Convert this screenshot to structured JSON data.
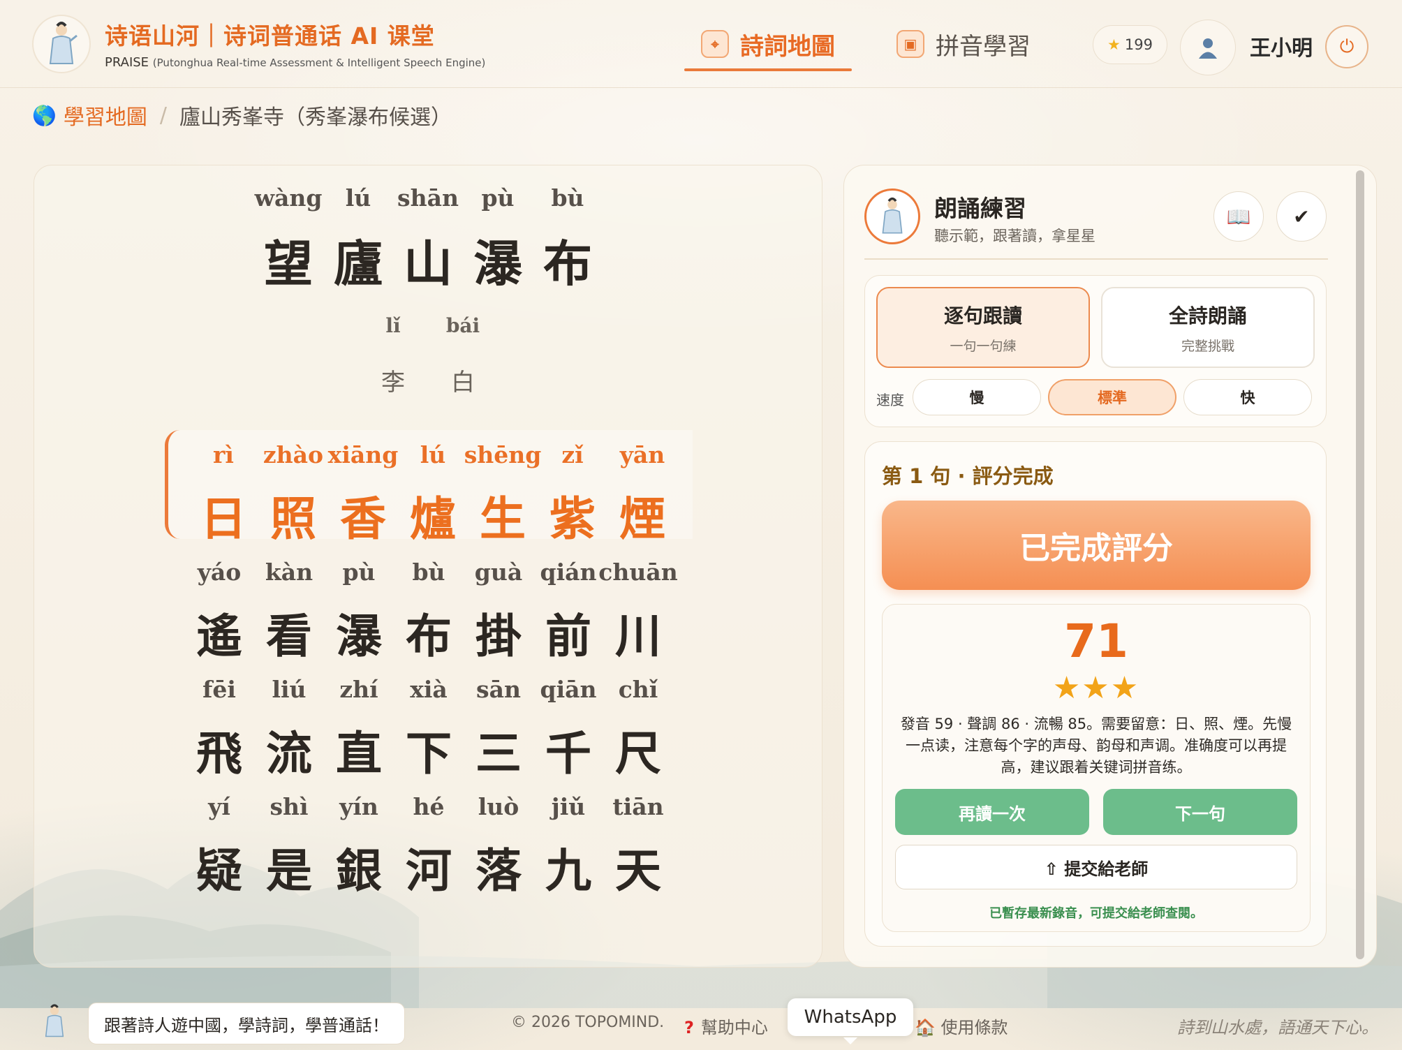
{
  "header": {
    "brand_title": "诗语山河｜诗词普通话 AI 课堂",
    "brand_acronym": "PRAISE",
    "brand_expansion": "(Putonghua Real-time Assessment & Intelligent Speech Engine)",
    "nav": [
      {
        "label": "詩詞地圖",
        "icon": "map-icon",
        "active": true
      },
      {
        "label": "拼音學習",
        "icon": "pinyin-card-icon",
        "active": false
      }
    ],
    "stars": "199",
    "user_name": "王小明"
  },
  "breadcrumb": {
    "root": "學習地圖",
    "separator": "/",
    "current": "廬山秀峯寺（秀峯瀑布候選）"
  },
  "poem": {
    "title": {
      "pinyin": [
        "wàng",
        "lú",
        "shān",
        "pù",
        "bù"
      ],
      "hanzi": [
        "望",
        "廬",
        "山",
        "瀑",
        "布"
      ]
    },
    "author": {
      "pinyin": [
        "lǐ",
        "bái"
      ],
      "hanzi": [
        "李",
        "白"
      ]
    },
    "lines": [
      {
        "active": true,
        "pinyin": [
          "rì",
          "zhào",
          "xiāng",
          "lú",
          "shēng",
          "zǐ",
          "yān"
        ],
        "hanzi": [
          "日",
          "照",
          "香",
          "爐",
          "生",
          "紫",
          "煙"
        ]
      },
      {
        "active": false,
        "pinyin": [
          "yáo",
          "kàn",
          "pù",
          "bù",
          "guà",
          "qián",
          "chuān"
        ],
        "hanzi": [
          "遙",
          "看",
          "瀑",
          "布",
          "掛",
          "前",
          "川"
        ]
      },
      {
        "active": false,
        "pinyin": [
          "fēi",
          "liú",
          "zhí",
          "xià",
          "sān",
          "qiān",
          "chǐ"
        ],
        "hanzi": [
          "飛",
          "流",
          "直",
          "下",
          "三",
          "千",
          "尺"
        ]
      },
      {
        "active": false,
        "pinyin": [
          "yí",
          "shì",
          "yín",
          "hé",
          "luò",
          "jiǔ",
          "tiān"
        ],
        "hanzi": [
          "疑",
          "是",
          "銀",
          "河",
          "落",
          "九",
          "天"
        ]
      }
    ]
  },
  "practice": {
    "title": "朗誦練習",
    "subtitle": "聽示範，跟著讀，拿星星",
    "modes": [
      {
        "name": "逐句跟讀",
        "desc": "一句一句練",
        "active": true
      },
      {
        "name": "全詩朗誦",
        "desc": "完整挑戰",
        "active": false
      }
    ],
    "speed_label": "速度",
    "speeds": [
      {
        "label": "慢",
        "active": false
      },
      {
        "label": "標準",
        "active": true
      },
      {
        "label": "快",
        "active": false
      }
    ],
    "result_heading": "第 1 句 · 評分完成",
    "status_button": "已完成評分",
    "score": "71",
    "stars_display": "★★★",
    "feedback": "發音 59 · 聲調 86 · 流暢 85。需要留意：日、照、煙。先慢一点读，注意每个字的声母、韵母和声调。准确度可以再提高，建议跟着关键词拼音练。",
    "retry_label": "再讀一次",
    "next_label": "下一句",
    "submit_label": "⇧ 提交給老師",
    "saved_note": "已暫存最新錄音，可提交給老師查閱。"
  },
  "footer": {
    "bubble": "跟著詩人遊中國，學詩詞，學普通話！",
    "copyright": "© 2026 TOPOMIND.",
    "help_mark": "?",
    "help": "幫助中心",
    "whatsapp": "WhatsApp",
    "terms": "使用條款",
    "slogan": "詩到山水處，語通天下心。"
  },
  "colors": {
    "accent": "#e86a24",
    "success": "#6cbd8b",
    "background": "#f6efe3"
  }
}
